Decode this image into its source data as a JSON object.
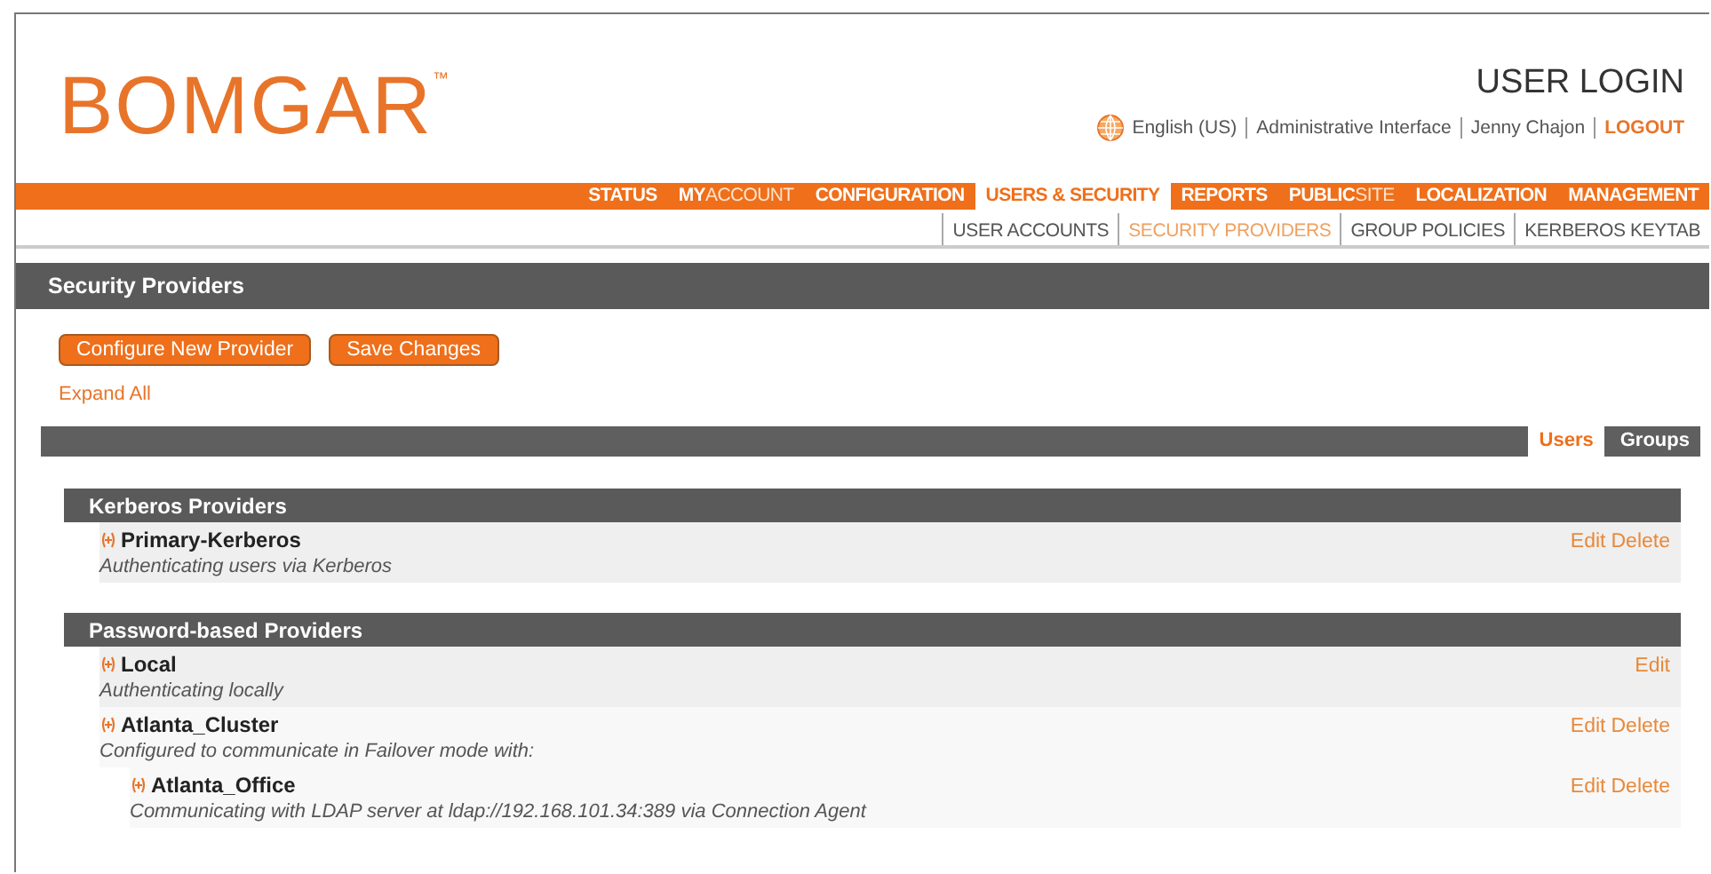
{
  "logo": {
    "text": "BOMGAR",
    "mark": "™"
  },
  "header": {
    "title": "USER LOGIN",
    "links": [
      {
        "kind": "language",
        "label": "English (US)"
      },
      {
        "kind": "text",
        "label": "Administrative Interface"
      },
      {
        "kind": "text",
        "label": "Jenny Chajon"
      },
      {
        "kind": "logout",
        "label": "LOGOUT"
      }
    ]
  },
  "nav": [
    {
      "strong": "STATUS",
      "selected": false
    },
    {
      "strong": "MY",
      "rest": "ACCOUNT",
      "selected": false
    },
    {
      "strong": "CONFIGURATION",
      "selected": false
    },
    {
      "strong": "USERS & SECURITY",
      "selected": true
    },
    {
      "strong": "REPORTS",
      "selected": false
    },
    {
      "strong": "PUBLIC",
      "rest": "SITE",
      "selected": false
    },
    {
      "strong": "LOCALIZATION",
      "selected": false
    },
    {
      "strong": "MANAGEMENT",
      "selected": false
    }
  ],
  "subnav": [
    {
      "label": "USER ACCOUNTS",
      "selected": false
    },
    {
      "label": "SECURITY PROVIDERS",
      "selected": true
    },
    {
      "label": "GROUP POLICIES",
      "selected": false
    },
    {
      "label": "KERBEROS KEYTAB",
      "selected": false
    }
  ],
  "section_title": "Security Providers",
  "buttons": [
    "Configure New Provider",
    "Save Changes"
  ],
  "expand_all": "Expand All",
  "view_tabs": [
    {
      "label": "Users",
      "selected": true
    },
    {
      "label": "Groups",
      "selected": false
    }
  ],
  "groups": [
    {
      "title": "Kerberos Providers",
      "providers": [
        {
          "name": "Primary-Kerberos",
          "description": "Authenticating users via Kerberos",
          "actions": [
            "Edit",
            "Delete"
          ]
        }
      ]
    },
    {
      "title": "Password-based Providers",
      "providers": [
        {
          "name": "Local",
          "description": "Authenticating locally",
          "actions": [
            "Edit"
          ]
        },
        {
          "name": "Atlanta_Cluster",
          "description": "Configured to communicate in Failover mode with:",
          "actions": [
            "Edit",
            "Delete"
          ],
          "children": [
            {
              "name": "Atlanta_Office",
              "description": "Communicating with LDAP server at ldap://192.168.101.34:389 via Connection Agent",
              "actions": [
                "Edit",
                "Delete"
              ]
            }
          ]
        }
      ]
    }
  ]
}
